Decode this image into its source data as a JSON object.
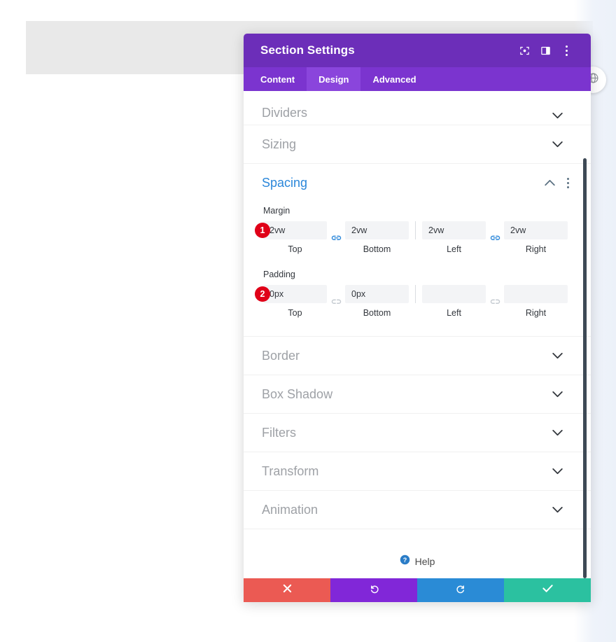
{
  "window": {
    "title": "Section Settings",
    "header_icons": [
      {
        "name": "focus-target-icon",
        "label": "Focus"
      },
      {
        "name": "layout-panel-icon",
        "label": "Panel Layout"
      },
      {
        "name": "kebab-menu-icon",
        "label": "More Options"
      }
    ]
  },
  "tabs": [
    {
      "label": "Content",
      "active": false
    },
    {
      "label": "Design",
      "active": true
    },
    {
      "label": "Advanced",
      "active": false
    }
  ],
  "sections_above": [
    {
      "label": "Dividers",
      "expanded": false,
      "icon": "chevron-down-icon"
    },
    {
      "label": "Sizing",
      "expanded": false,
      "icon": "chevron-down-icon"
    }
  ],
  "spacing": {
    "title": "Spacing",
    "expanded": true,
    "collapse_icon": "chevron-up-icon",
    "menu_icon": "kebab-menu-icon",
    "margin": {
      "label": "Margin",
      "badge": "1",
      "link_left": {
        "state": "linked",
        "icon": "link-chain-icon"
      },
      "link_right": {
        "state": "linked",
        "icon": "link-chain-icon"
      },
      "fields": [
        {
          "caption": "Top",
          "value": "2vw",
          "placeholder": ""
        },
        {
          "caption": "Bottom",
          "value": "2vw",
          "placeholder": ""
        },
        {
          "caption": "Left",
          "value": "2vw",
          "placeholder": ""
        },
        {
          "caption": "Right",
          "value": "2vw",
          "placeholder": ""
        }
      ]
    },
    "padding": {
      "label": "Padding",
      "badge": "2",
      "link_left": {
        "state": "unlinked",
        "icon": "broken-link-icon"
      },
      "link_right": {
        "state": "unlinked",
        "icon": "broken-link-icon"
      },
      "fields": [
        {
          "caption": "Top",
          "value": "0px",
          "placeholder": ""
        },
        {
          "caption": "Bottom",
          "value": "0px",
          "placeholder": ""
        },
        {
          "caption": "Left",
          "value": "",
          "placeholder": ""
        },
        {
          "caption": "Right",
          "value": "",
          "placeholder": ""
        }
      ]
    }
  },
  "sections_below": [
    {
      "label": "Border",
      "expanded": false,
      "icon": "chevron-down-icon"
    },
    {
      "label": "Box Shadow",
      "expanded": false,
      "icon": "chevron-down-icon"
    },
    {
      "label": "Filters",
      "expanded": false,
      "icon": "chevron-down-icon"
    },
    {
      "label": "Transform",
      "expanded": false,
      "icon": "chevron-down-icon"
    },
    {
      "label": "Animation",
      "expanded": false,
      "icon": "chevron-down-icon"
    }
  ],
  "help": {
    "label": "Help",
    "icon": "help-question-icon"
  },
  "footer": {
    "buttons": [
      {
        "name": "cancel-button",
        "icon": "close-x-icon",
        "color": "#eb5a53"
      },
      {
        "name": "undo-button",
        "icon": "undo-arrow-icon",
        "color": "#8127d8"
      },
      {
        "name": "redo-button",
        "icon": "redo-arrow-icon",
        "color": "#2a8bd6"
      },
      {
        "name": "save-button",
        "icon": "checkmark-icon",
        "color": "#2bc1a0"
      }
    ]
  },
  "floating": {
    "globe_button": {
      "icon": "globe-icon"
    }
  },
  "colors": {
    "header_purple": "#6C2EB9",
    "tabs_purple": "#7B34CF",
    "tab_active_purple": "#8A45DC",
    "accent_blue": "#2b87da",
    "badge_red": "#e00018",
    "field_gray": "#f3f4f6",
    "muted_text": "#9ea1a6"
  }
}
